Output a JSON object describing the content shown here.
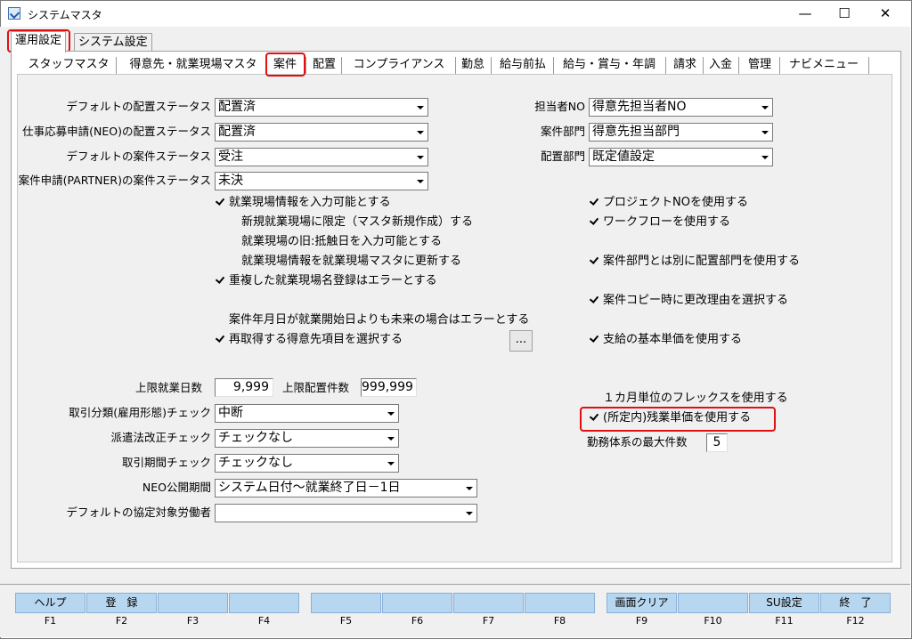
{
  "window": {
    "title": "システムマスタ",
    "minimize": "—",
    "maximize": "☐",
    "close": "✕"
  },
  "top_tabs": [
    "運用設定",
    "システム設定"
  ],
  "inner_tabs": [
    "スタッフマスタ",
    "得意先・就業現場マスタ",
    "案件",
    "配置",
    "コンプライアンス",
    "勤怠",
    "給与前払",
    "給与・賞与・年調",
    "請求",
    "入金",
    "管理",
    "ナビメニュー"
  ],
  "left_combos": [
    {
      "label": "デフォルトの配置ステータス",
      "value": "配置済"
    },
    {
      "label": "仕事応募申請(NEO)の配置ステータス",
      "value": "配置済"
    },
    {
      "label": "デフォルトの案件ステータス",
      "value": "受注"
    },
    {
      "label": "案件申請(PARTNER)の案件ステータス",
      "value": "未決"
    }
  ],
  "right_combos": [
    {
      "label": "担当者NO",
      "value": "得意先担当者NO"
    },
    {
      "label": "案件部門",
      "value": "得意先担当部門"
    },
    {
      "label": "配置部門",
      "value": "既定値設定"
    }
  ],
  "left_checks": [
    {
      "label": "就業現場情報を入力可能とする",
      "checked": true
    },
    {
      "label": "新規就業現場に限定（マスタ新規作成）する",
      "checked": false
    },
    {
      "label": "就業現場の旧:抵触日を入力可能とする",
      "checked": false
    },
    {
      "label": "就業現場情報を就業現場マスタに更新する",
      "checked": false
    },
    {
      "label": "重複した就業現場名登録はエラーとする",
      "checked": true
    },
    {
      "label": "案件年月日が就業開始日よりも未来の場合はエラーとする",
      "checked": false
    },
    {
      "label": "再取得する得意先項目を選択する",
      "checked": true
    }
  ],
  "dots_button": "...",
  "right_checks": [
    {
      "label": "プロジェクトNOを使用する",
      "checked": true
    },
    {
      "label": "ワークフローを使用する",
      "checked": true
    },
    {
      "label": "案件部門とは別に配置部門を使用する",
      "checked": true
    },
    {
      "label": "案件コピー時に更改理由を選択する",
      "checked": true
    },
    {
      "label": "支給の基本単価を使用する",
      "checked": true
    },
    {
      "label": "１カ月単位のフレックスを使用する",
      "checked": false
    },
    {
      "label": "(所定内)残業単価を使用する",
      "checked": true
    }
  ],
  "limits": {
    "days_label": "上限就業日数",
    "days_value": "9,999",
    "count_label": "上限配置件数",
    "count_value": "999,999"
  },
  "lower_combos": [
    {
      "label": "取引分類(雇用形態)チェック",
      "value": "中断"
    },
    {
      "label": "派遣法改正チェック",
      "value": "チェックなし"
    },
    {
      "label": "取引期間チェック",
      "value": "チェックなし"
    },
    {
      "label": "NEO公開期間",
      "value": "システム日付〜就業終了日－1日"
    },
    {
      "label": "デフォルトの協定対象労働者",
      "value": ""
    }
  ],
  "max_schedule": {
    "label": "勤務体系の最大件数",
    "value": "5"
  },
  "fkeys": [
    {
      "label": "ヘルプ",
      "key": "F1"
    },
    {
      "label": "登　録",
      "key": "F2"
    },
    {
      "label": "",
      "key": "F3"
    },
    {
      "label": "",
      "key": "F4"
    },
    {
      "label": "",
      "key": "F5"
    },
    {
      "label": "",
      "key": "F6"
    },
    {
      "label": "",
      "key": "F7"
    },
    {
      "label": "",
      "key": "F8"
    },
    {
      "label": "画面クリア",
      "key": "F9"
    },
    {
      "label": "",
      "key": "F10"
    },
    {
      "label": "SU設定",
      "key": "F11"
    },
    {
      "label": "終　了",
      "key": "F12"
    }
  ]
}
